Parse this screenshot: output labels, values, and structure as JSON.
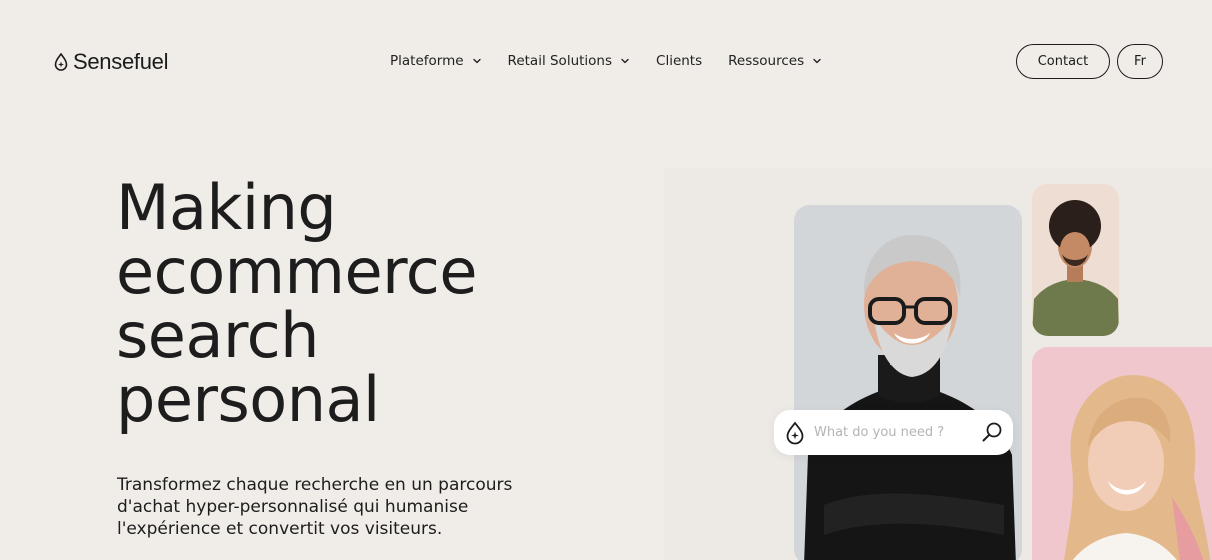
{
  "brand": {
    "name": "Sensefuel"
  },
  "nav": {
    "items": [
      {
        "label": "Plateforme",
        "has_dropdown": true
      },
      {
        "label": "Retail Solutions",
        "has_dropdown": true
      },
      {
        "label": "Clients",
        "has_dropdown": false
      },
      {
        "label": "Ressources",
        "has_dropdown": true
      }
    ]
  },
  "header": {
    "contact_label": "Contact",
    "lang_label": "Fr"
  },
  "hero": {
    "title_lines": [
      "Making",
      "ecommerce",
      "search",
      "personal"
    ],
    "subtitle": "Transformez chaque recherche en un parcours d'achat hyper-personnalisé qui humanise l'expérience et convertit vos visiteurs."
  },
  "search": {
    "placeholder": "What do you need ?",
    "value": ""
  },
  "icons": {
    "logo": "drop-logo-icon",
    "dropdown": "chevron-down-icon",
    "search": "magnifier-icon",
    "search_brand": "drop-sparkle-icon"
  },
  "colors": {
    "background": "#f0ece8",
    "text": "#1c1c1c",
    "card_gray": "#d5d8db",
    "card_peach": "#efdcd2",
    "card_pink": "#f1c8ce"
  }
}
